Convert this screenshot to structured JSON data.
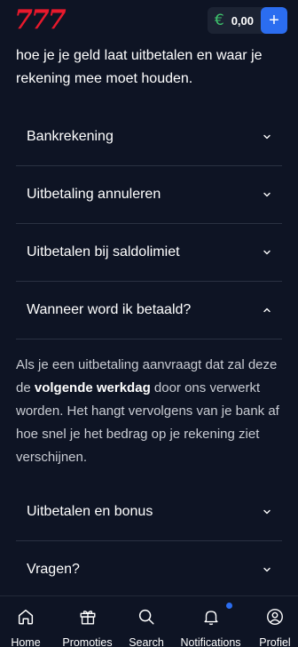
{
  "header": {
    "logo_text": "777",
    "balance": "0,00",
    "currency_icon": "euro-icon",
    "deposit_icon": "plus-icon"
  },
  "intro_text": "hoe je je geld laat uitbetalen en waar je rekening mee moet houden.",
  "faq": [
    {
      "question": "Bankrekening",
      "expanded": false
    },
    {
      "question": "Uitbetaling annuleren",
      "expanded": false
    },
    {
      "question": "Uitbetalen bij saldolimiet",
      "expanded": false
    },
    {
      "question": "Wanneer word ik betaald?",
      "expanded": true,
      "answer_pre": "Als je een uitbetaling aanvraagt dat zal deze de ",
      "answer_bold": "volgende werkdag",
      "answer_post": " door ons verwerkt worden. Het hangt vervolgens van je bank af hoe snel je het bedrag op je rekening ziet verschijnen."
    },
    {
      "question": "Uitbetalen en bonus",
      "expanded": false
    },
    {
      "question": "Vragen?",
      "expanded": false
    }
  ],
  "bottom_nav": [
    {
      "label": "Home",
      "icon": "home-icon"
    },
    {
      "label": "Promoties",
      "icon": "gift-icon"
    },
    {
      "label": "Search",
      "icon": "search-icon"
    },
    {
      "label": "Notifications",
      "icon": "bell-icon"
    },
    {
      "label": "Profiel",
      "icon": "user-icon"
    }
  ],
  "colors": {
    "background": "#0e1424",
    "brand_red": "#e8192c",
    "accent_blue": "#2b6df0",
    "euro_green": "#3ec46d"
  }
}
